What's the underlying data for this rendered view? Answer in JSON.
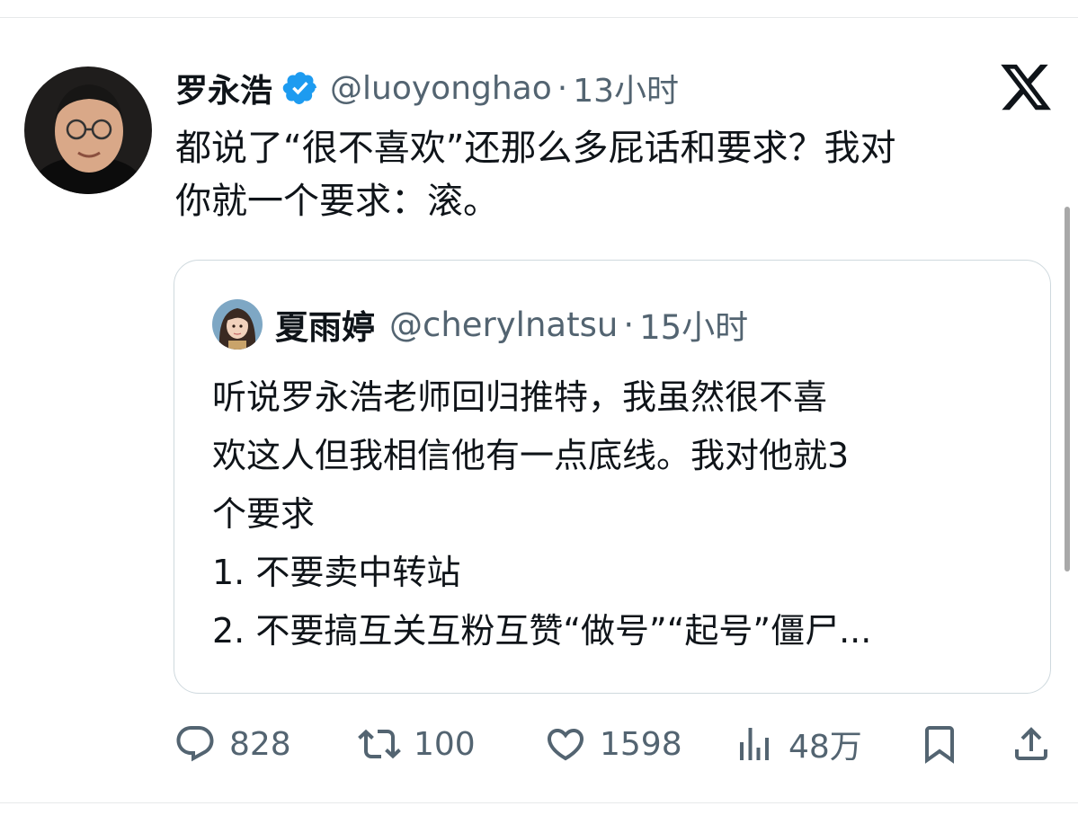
{
  "tweet": {
    "author_name": "罗永浩",
    "handle": "@luoyonghao",
    "separator": "·",
    "time": "13小时",
    "text": "都说了“很不喜欢”还那么多屁话和要求？我对\n你就一个要求：滚。"
  },
  "quoted_tweet": {
    "author_name": "夏雨婷",
    "handle": "@cherylnatsu",
    "separator": "·",
    "time": "15小时",
    "text": "听说罗永浩老师回归推特，我虽然很不喜\n欢这人但我相信他有一点底线。我对他就3\n个要求\n1. 不要卖中转站\n2. 不要搞互关互粉互赞“做号”“起号”僵尸..."
  },
  "actions": {
    "replies": "828",
    "retweets": "100",
    "likes": "1598",
    "views": "48万"
  },
  "colors": {
    "text_primary": "#0f1419",
    "text_secondary": "#536471",
    "verified_blue": "#1d9bf0",
    "border": "#cfd9de"
  },
  "icons": [
    "verified-badge-icon",
    "x-logo-icon",
    "reply-icon",
    "retweet-icon",
    "like-icon",
    "views-icon",
    "bookmark-icon",
    "share-icon"
  ]
}
